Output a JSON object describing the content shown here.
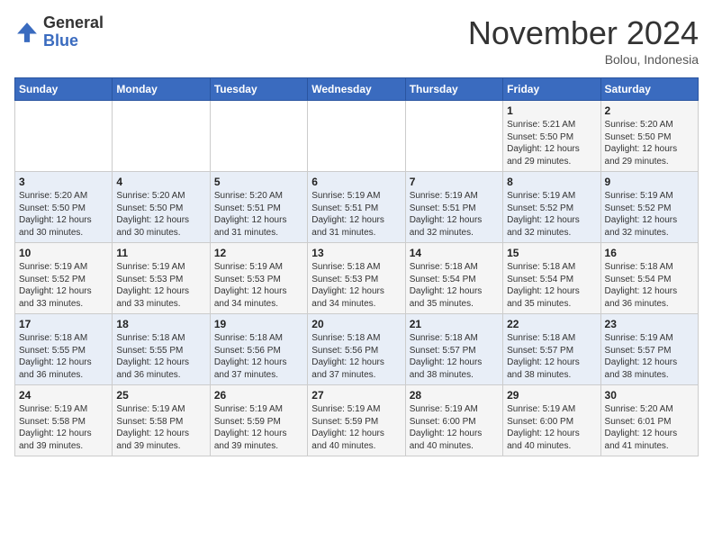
{
  "header": {
    "logo_general": "General",
    "logo_blue": "Blue",
    "month": "November 2024",
    "location": "Bolou, Indonesia"
  },
  "weekdays": [
    "Sunday",
    "Monday",
    "Tuesday",
    "Wednesday",
    "Thursday",
    "Friday",
    "Saturday"
  ],
  "weeks": [
    [
      {
        "day": "",
        "info": ""
      },
      {
        "day": "",
        "info": ""
      },
      {
        "day": "",
        "info": ""
      },
      {
        "day": "",
        "info": ""
      },
      {
        "day": "",
        "info": ""
      },
      {
        "day": "1",
        "info": "Sunrise: 5:21 AM\nSunset: 5:50 PM\nDaylight: 12 hours and 29 minutes."
      },
      {
        "day": "2",
        "info": "Sunrise: 5:20 AM\nSunset: 5:50 PM\nDaylight: 12 hours and 29 minutes."
      }
    ],
    [
      {
        "day": "3",
        "info": "Sunrise: 5:20 AM\nSunset: 5:50 PM\nDaylight: 12 hours and 30 minutes."
      },
      {
        "day": "4",
        "info": "Sunrise: 5:20 AM\nSunset: 5:50 PM\nDaylight: 12 hours and 30 minutes."
      },
      {
        "day": "5",
        "info": "Sunrise: 5:20 AM\nSunset: 5:51 PM\nDaylight: 12 hours and 31 minutes."
      },
      {
        "day": "6",
        "info": "Sunrise: 5:19 AM\nSunset: 5:51 PM\nDaylight: 12 hours and 31 minutes."
      },
      {
        "day": "7",
        "info": "Sunrise: 5:19 AM\nSunset: 5:51 PM\nDaylight: 12 hours and 32 minutes."
      },
      {
        "day": "8",
        "info": "Sunrise: 5:19 AM\nSunset: 5:52 PM\nDaylight: 12 hours and 32 minutes."
      },
      {
        "day": "9",
        "info": "Sunrise: 5:19 AM\nSunset: 5:52 PM\nDaylight: 12 hours and 32 minutes."
      }
    ],
    [
      {
        "day": "10",
        "info": "Sunrise: 5:19 AM\nSunset: 5:52 PM\nDaylight: 12 hours and 33 minutes."
      },
      {
        "day": "11",
        "info": "Sunrise: 5:19 AM\nSunset: 5:53 PM\nDaylight: 12 hours and 33 minutes."
      },
      {
        "day": "12",
        "info": "Sunrise: 5:19 AM\nSunset: 5:53 PM\nDaylight: 12 hours and 34 minutes."
      },
      {
        "day": "13",
        "info": "Sunrise: 5:18 AM\nSunset: 5:53 PM\nDaylight: 12 hours and 34 minutes."
      },
      {
        "day": "14",
        "info": "Sunrise: 5:18 AM\nSunset: 5:54 PM\nDaylight: 12 hours and 35 minutes."
      },
      {
        "day": "15",
        "info": "Sunrise: 5:18 AM\nSunset: 5:54 PM\nDaylight: 12 hours and 35 minutes."
      },
      {
        "day": "16",
        "info": "Sunrise: 5:18 AM\nSunset: 5:54 PM\nDaylight: 12 hours and 36 minutes."
      }
    ],
    [
      {
        "day": "17",
        "info": "Sunrise: 5:18 AM\nSunset: 5:55 PM\nDaylight: 12 hours and 36 minutes."
      },
      {
        "day": "18",
        "info": "Sunrise: 5:18 AM\nSunset: 5:55 PM\nDaylight: 12 hours and 36 minutes."
      },
      {
        "day": "19",
        "info": "Sunrise: 5:18 AM\nSunset: 5:56 PM\nDaylight: 12 hours and 37 minutes."
      },
      {
        "day": "20",
        "info": "Sunrise: 5:18 AM\nSunset: 5:56 PM\nDaylight: 12 hours and 37 minutes."
      },
      {
        "day": "21",
        "info": "Sunrise: 5:18 AM\nSunset: 5:57 PM\nDaylight: 12 hours and 38 minutes."
      },
      {
        "day": "22",
        "info": "Sunrise: 5:18 AM\nSunset: 5:57 PM\nDaylight: 12 hours and 38 minutes."
      },
      {
        "day": "23",
        "info": "Sunrise: 5:19 AM\nSunset: 5:57 PM\nDaylight: 12 hours and 38 minutes."
      }
    ],
    [
      {
        "day": "24",
        "info": "Sunrise: 5:19 AM\nSunset: 5:58 PM\nDaylight: 12 hours and 39 minutes."
      },
      {
        "day": "25",
        "info": "Sunrise: 5:19 AM\nSunset: 5:58 PM\nDaylight: 12 hours and 39 minutes."
      },
      {
        "day": "26",
        "info": "Sunrise: 5:19 AM\nSunset: 5:59 PM\nDaylight: 12 hours and 39 minutes."
      },
      {
        "day": "27",
        "info": "Sunrise: 5:19 AM\nSunset: 5:59 PM\nDaylight: 12 hours and 40 minutes."
      },
      {
        "day": "28",
        "info": "Sunrise: 5:19 AM\nSunset: 6:00 PM\nDaylight: 12 hours and 40 minutes."
      },
      {
        "day": "29",
        "info": "Sunrise: 5:19 AM\nSunset: 6:00 PM\nDaylight: 12 hours and 40 minutes."
      },
      {
        "day": "30",
        "info": "Sunrise: 5:20 AM\nSunset: 6:01 PM\nDaylight: 12 hours and 41 minutes."
      }
    ]
  ]
}
